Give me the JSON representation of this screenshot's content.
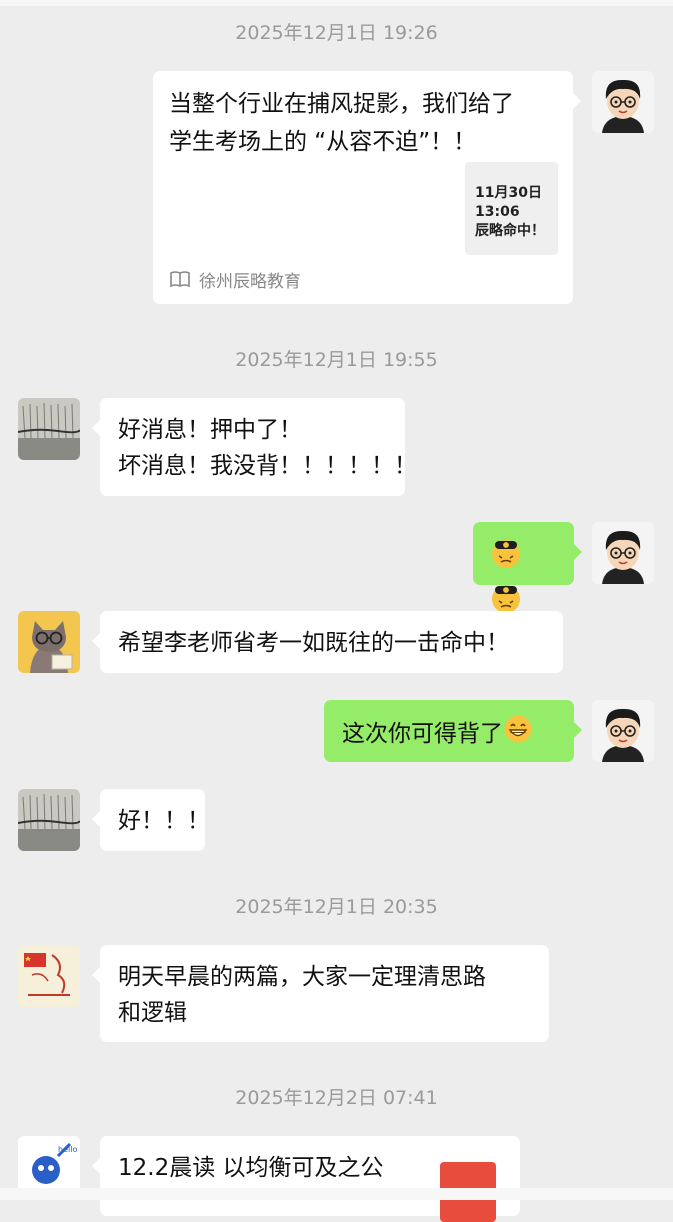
{
  "timestamps": [
    "2025年12月1日 19:26",
    "2025年12月1日 19:55",
    "2025年12月1日 20:35",
    "2025年12月2日 07:41"
  ],
  "article_card": {
    "title_lines": [
      "当整个行业在捕风捉影，我们给了",
      "学生考场上的 “从容不迫”！！"
    ],
    "thumb_lines": [
      "11月30日",
      "13:06",
      "辰略命中！"
    ],
    "source": "徐州辰略教育",
    "source_icon": "book-icon"
  },
  "messages": {
    "m1_lines": [
      "好消息！押中了！",
      "坏消息！我没背！！！！！！"
    ],
    "m2_emoji": "facepalm-emoji",
    "m3": "希望李老师省考一如既往的一击命中！",
    "m4_text": "这次你可得背了",
    "m4_emoji": "grin-emoji",
    "m5": "好！！！",
    "m6_lines": [
      "明天早晨的两篇，大家一定理清思路",
      "和逻辑"
    ],
    "m7": "12.2晨读 以均衡可及之公"
  },
  "colors": {
    "background": "#ededed",
    "incoming_bubble": "#ffffff",
    "outgoing_bubble": "#95ec69",
    "timestamp": "#9a9a9a",
    "file_icon": "#e74c3c"
  }
}
